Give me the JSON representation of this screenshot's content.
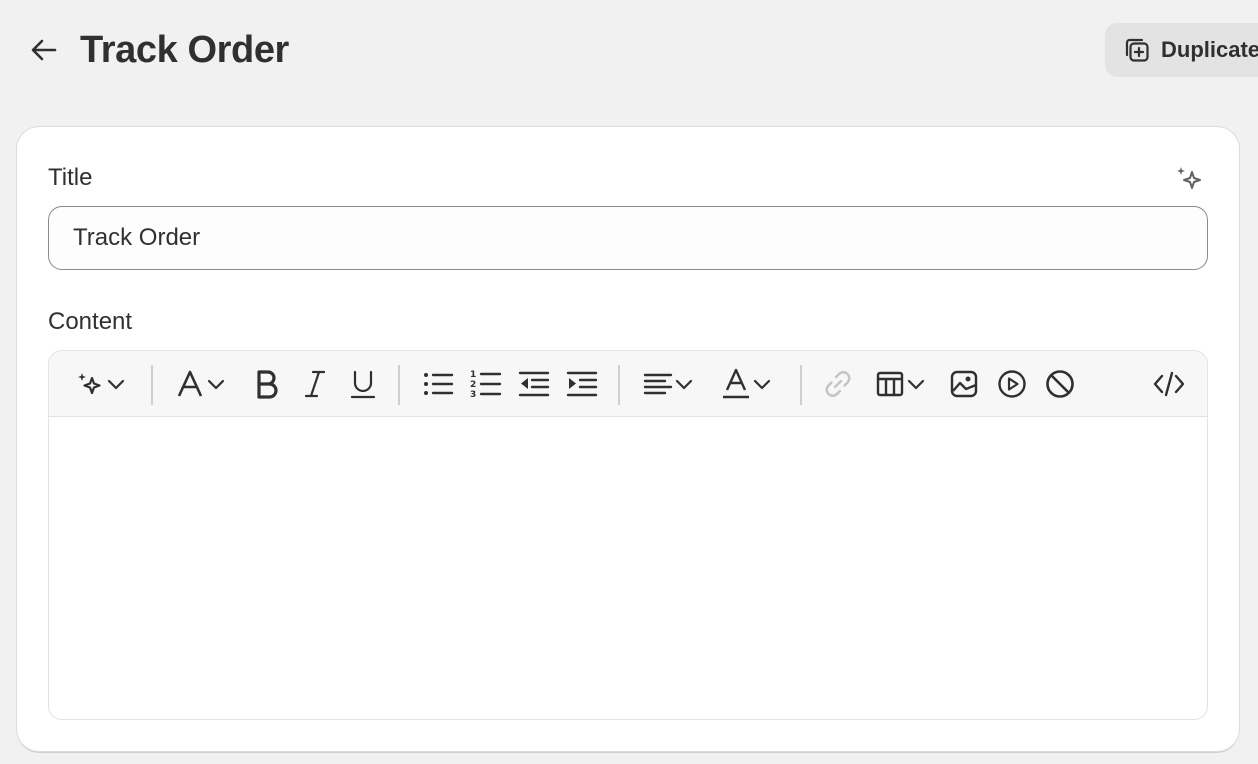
{
  "header": {
    "title": "Track Order",
    "duplicate_label": "Duplicate"
  },
  "form": {
    "title_label": "Title",
    "title_value": "Track Order",
    "content_label": "Content"
  },
  "toolbar": {
    "items": [
      "magic-ai-icon",
      "text-format-icon",
      "bold-icon",
      "italic-icon",
      "underline-icon",
      "bullet-list-icon",
      "numbered-list-icon",
      "outdent-icon",
      "indent-icon",
      "align-icon",
      "text-color-icon",
      "link-icon",
      "table-icon",
      "image-icon",
      "video-icon",
      "clear-format-icon",
      "code-view-icon"
    ]
  },
  "colors": {
    "background": "#f1f1f1",
    "card": "#ffffff",
    "text": "#303030",
    "button_bg": "#e3e3e3",
    "disabled_icon": "#b5b5b5"
  }
}
